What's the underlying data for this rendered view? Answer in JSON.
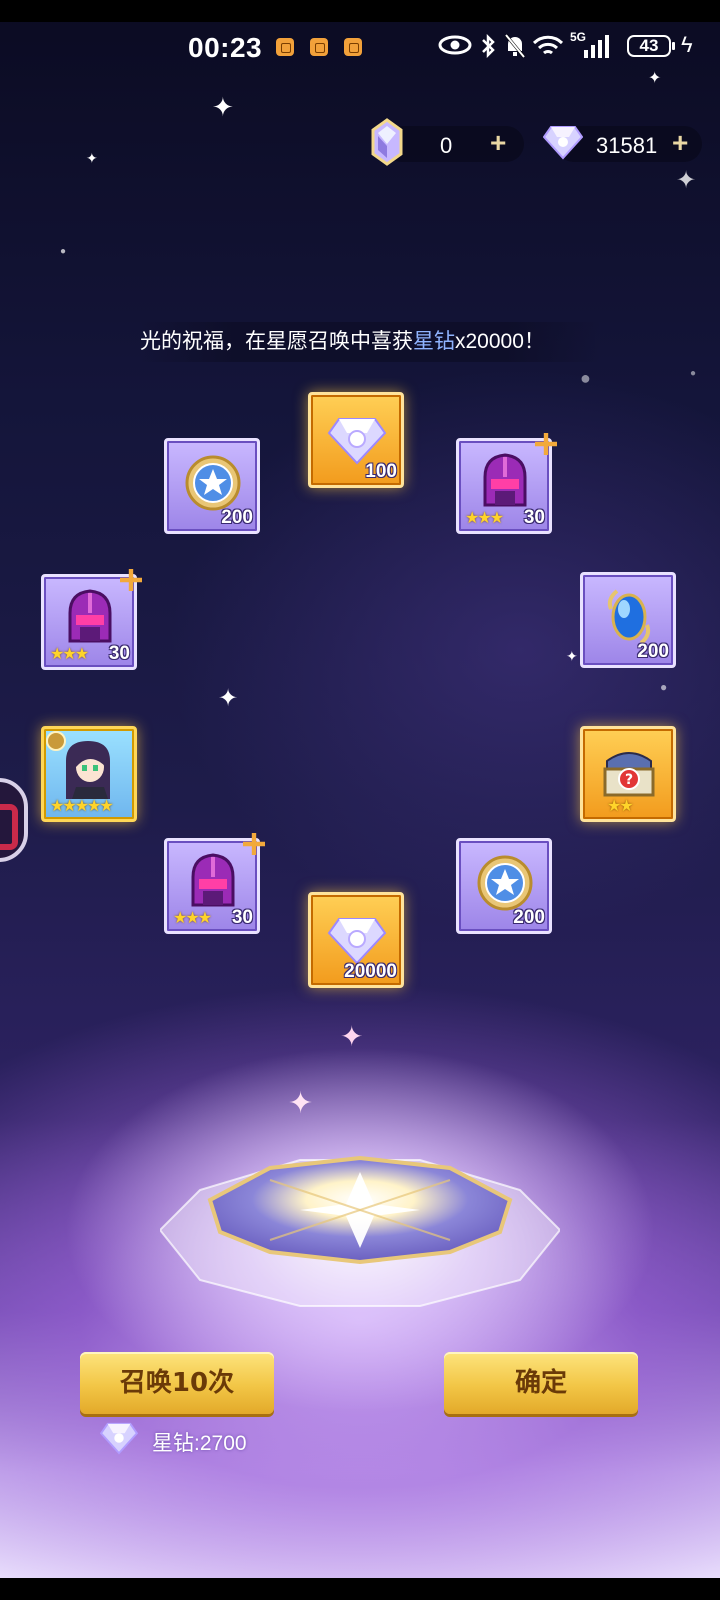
{
  "status_bar": {
    "time": "00:23",
    "battery": "43",
    "network": "5G"
  },
  "currencies": {
    "crystal": {
      "icon": "crystal-icon",
      "value": "0"
    },
    "star_diamond": {
      "icon": "diamond-icon",
      "value": "31581"
    }
  },
  "marquee": {
    "prefix": "光的祝福，在星愿召唤中喜获",
    "highlight": "星钻",
    "suffix": "x20000！"
  },
  "rewards": [
    {
      "id": "top",
      "type": "gold",
      "icon": "diamond-icon",
      "qty": "100",
      "stars": 0
    },
    {
      "id": "upper-left",
      "type": "purple",
      "icon": "medal-icon",
      "qty": "200",
      "stars": 0
    },
    {
      "id": "upper-right",
      "type": "purple",
      "icon": "helmet-icon",
      "qty": "30",
      "stars": 3
    },
    {
      "id": "mid-left",
      "type": "purple",
      "icon": "helmet-icon",
      "qty": "30",
      "stars": 3
    },
    {
      "id": "mid-right",
      "type": "purple",
      "icon": "sapphire-icon",
      "qty": "200",
      "stars": 0
    },
    {
      "id": "hero-left",
      "type": "hero",
      "icon": "hero-portrait-icon",
      "qty": "",
      "stars": 5
    },
    {
      "id": "chest-right",
      "type": "gold",
      "icon": "mystery-chest-icon",
      "qty": "",
      "stars": 2
    },
    {
      "id": "lower-left",
      "type": "purple",
      "icon": "helmet-icon",
      "qty": "30",
      "stars": 3
    },
    {
      "id": "lower-right",
      "type": "purple",
      "icon": "medal-icon",
      "qty": "200",
      "stars": 0
    },
    {
      "id": "bottom",
      "type": "gold",
      "icon": "diamond-icon",
      "qty": "20000",
      "stars": 0
    }
  ],
  "buttons": {
    "summon10": "召唤10次",
    "confirm": "确定"
  },
  "cost": {
    "label": "星钻:2700"
  },
  "colors": {
    "button_gold": "#f2c646",
    "highlight_blue": "#8fb3ff",
    "star_yellow": "#ffd42a"
  }
}
